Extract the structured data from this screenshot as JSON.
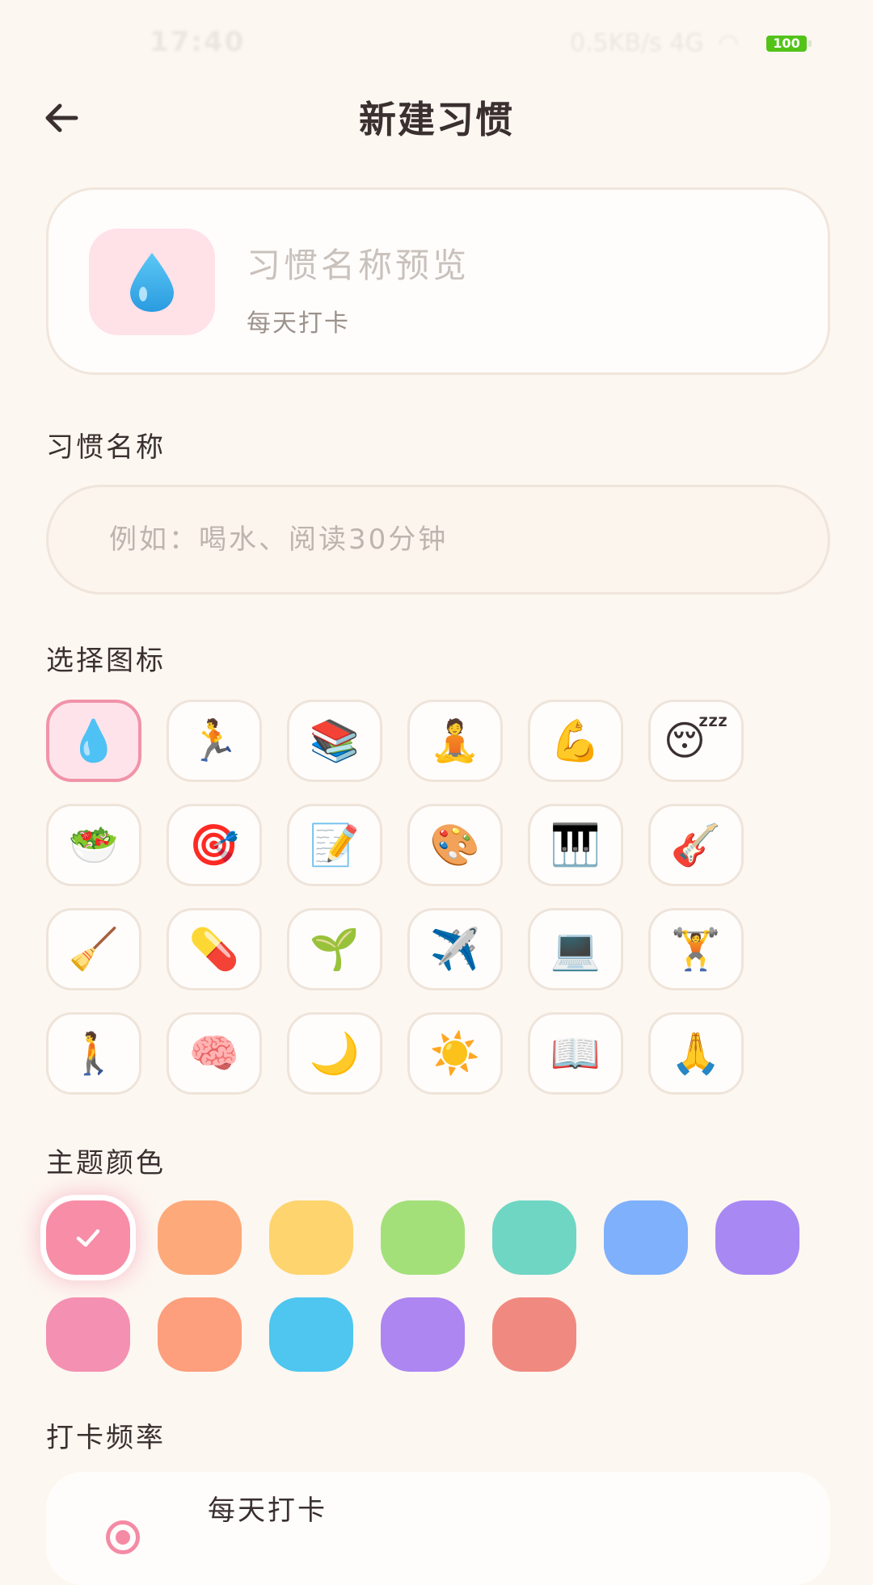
{
  "status_bar": {
    "time": "17:40",
    "network": "0.5KB/s 4G",
    "wifi": "wifi",
    "battery": "100"
  },
  "header": {
    "title": "新建习惯",
    "back_icon": "arrow-left-icon"
  },
  "preview": {
    "icon": "💧",
    "name": "习惯名称预览",
    "frequency": "每天打卡"
  },
  "name_section": {
    "label": "习惯名称",
    "placeholder": "例如：喝水、阅读30分钟",
    "value": ""
  },
  "icon_section": {
    "label": "选择图标",
    "icons": [
      "💧",
      "🏃",
      "📚",
      "🧘",
      "💪",
      "😴",
      "🥗",
      "🎯",
      "📝",
      "🎨",
      "🎹",
      "🎸",
      "🧹",
      "💊",
      "🌱",
      "✈️",
      "💻",
      "🏋️",
      "🚶",
      "🧠",
      "🌙",
      "☀️",
      "📖",
      "🙏"
    ],
    "selected_index": 0
  },
  "color_section": {
    "label": "主题颜色",
    "colors": [
      "#f78da7",
      "#fda97a",
      "#fdd46d",
      "#a3e07a",
      "#6fd6c4",
      "#7fb0fb",
      "#a888f3",
      "#f490b1",
      "#fd9e7c",
      "#4ec6f0",
      "#ad86f1",
      "#f08a80"
    ],
    "selected_index": 0
  },
  "frequency_section": {
    "label": "打卡频率",
    "option": "每天打卡"
  }
}
